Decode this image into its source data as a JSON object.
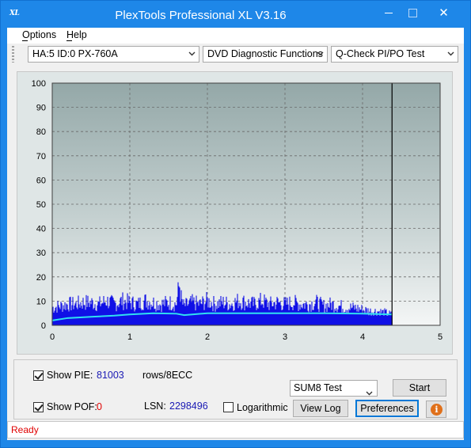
{
  "window": {
    "title": "PlexTools Professional XL V3.16",
    "app_icon_text": "XL",
    "close_glyph": "✕"
  },
  "menu": {
    "items": [
      {
        "label": "Options"
      },
      {
        "label": "Help"
      }
    ]
  },
  "toolbar": {
    "drive": "HA:5 ID:0  PX-760A",
    "function": "DVD Diagnostic Functions",
    "test": "Q-Check PI/PO Test"
  },
  "chart_data": {
    "type": "area",
    "x_ticks": [
      "0",
      "1",
      "2",
      "3",
      "4",
      "5"
    ],
    "y_ticks": [
      "0",
      "10",
      "20",
      "30",
      "40",
      "50",
      "60",
      "70",
      "80",
      "90",
      "100"
    ],
    "xlim": [
      0,
      5
    ],
    "ylim": [
      0,
      100
    ],
    "grid": true,
    "scan_end_x": 4.38,
    "series": [
      {
        "type": "area",
        "color": "#1010e6",
        "x": [
          0.0,
          0.1,
          0.2,
          0.3,
          0.4,
          0.5,
          0.6,
          0.7,
          0.8,
          0.9,
          1.0,
          1.1,
          1.2,
          1.3,
          1.4,
          1.5,
          1.6,
          1.64,
          1.66,
          1.68,
          1.7,
          1.8,
          1.9,
          2.0,
          2.1,
          2.2,
          2.3,
          2.4,
          2.5,
          2.6,
          2.7,
          2.8,
          2.9,
          3.0,
          3.1,
          3.2,
          3.3,
          3.4,
          3.5,
          3.6,
          3.7,
          3.8,
          3.9,
          4.0,
          4.1,
          4.2,
          4.3,
          4.38
        ],
        "y": [
          10,
          11,
          12,
          12,
          13,
          13,
          12,
          14,
          12,
          14,
          13,
          12,
          14,
          13,
          12,
          13,
          12,
          24,
          16,
          12,
          11,
          13,
          12,
          14,
          12,
          13,
          12,
          14,
          13,
          12,
          14,
          12,
          13,
          12,
          13,
          12,
          12,
          13,
          11,
          12,
          11,
          10,
          10,
          9,
          8,
          8,
          7,
          6
        ]
      },
      {
        "type": "line",
        "color": "#30e0f0",
        "x": [
          0.0,
          0.2,
          0.5,
          0.8,
          1.0,
          1.3,
          1.6,
          1.7,
          2.0,
          2.5,
          3.0,
          3.5,
          4.0,
          4.38
        ],
        "y": [
          2,
          3,
          3.5,
          4,
          4.5,
          5,
          4.8,
          4.2,
          5,
          5,
          5,
          5,
          4.8,
          4.5
        ]
      }
    ]
  },
  "controls": {
    "show_pie_label": "Show PIE:",
    "pie_value": "81003",
    "pie_units": "rows/8ECC",
    "show_pof_label": "Show POF:",
    "pof_value": "0",
    "lsn_label": "LSN:",
    "lsn_value": "2298496",
    "logarithmic_label": "Logarithmic",
    "sum_select": "SUM8 Test",
    "start_button": "Start",
    "view_log_button": "View Log",
    "preferences_button": "Preferences",
    "info_glyph": "i"
  },
  "status": {
    "text": "Ready"
  }
}
